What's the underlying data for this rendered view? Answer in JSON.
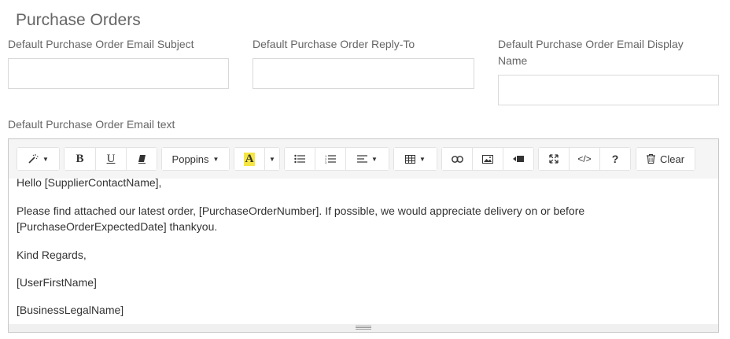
{
  "page": {
    "title": "Purchase Orders"
  },
  "fields": {
    "subject": {
      "label": "Default Purchase Order Email Subject",
      "value": ""
    },
    "reply_to": {
      "label": "Default Purchase Order Reply-To",
      "value": ""
    },
    "display_name": {
      "label_line1": "Default Purchase Order Email Display",
      "label_line2": "Name",
      "value": ""
    },
    "email_text": {
      "label": "Default Purchase Order Email text"
    }
  },
  "toolbar": {
    "font_name": "Poppins",
    "clear_label": "Clear",
    "code_label": "</>",
    "help_label": "?",
    "bold_label": "B",
    "underline_label": "U",
    "font_color_label": "A",
    "highlight_color": "#f5e642"
  },
  "editor": {
    "line1": "Hello [SupplierContactName],",
    "line2a": "Please find attached our latest order, [PurchaseOrderNumber].  If possible, we would appreciate delivery on or before",
    "line2b": "[PurchaseOrderExpectedDate] thankyou.",
    "line3": "Kind Regards,",
    "line4": "[UserFirstName]",
    "line5": "[BusinessLegalName]"
  }
}
